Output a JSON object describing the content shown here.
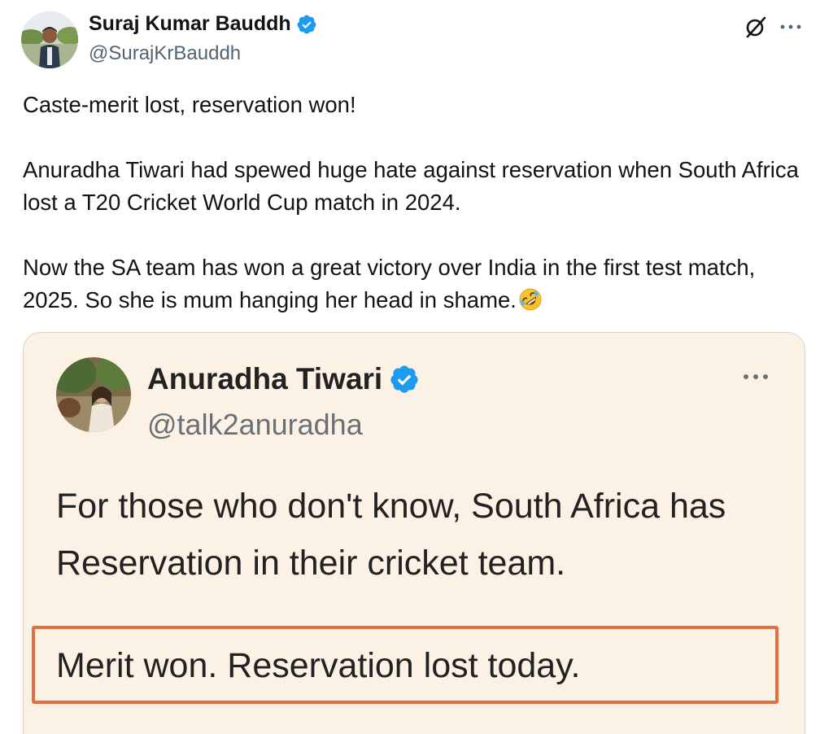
{
  "tweet": {
    "author": {
      "name": "Suraj Kumar Bauddh",
      "handle": "@SurajKrBauddh",
      "verified": true
    },
    "text": {
      "line1": "Caste-merit lost, reservation won!",
      "paragraph2": "Anuradha Tiwari had spewed huge hate against reservation when South Africa lost a T20 Cricket World Cup match in 2024.",
      "paragraph3": "Now the SA team has won a great victory over India in the first test match, 2025. So she is mum hanging her head in shame.",
      "emoji": "rolling-on-floor-laughing"
    },
    "icons": {
      "grok": "grok-icon",
      "more": "more-icon"
    }
  },
  "quoted": {
    "author": {
      "name": "Anuradha Tiwari",
      "handle": "@talk2anuradha",
      "verified": true
    },
    "text": "For those who don't know, South Africa has Reservation in their cricket team.",
    "highlighted_text": "Merit won. Reservation lost today.",
    "highlight_color": "#e07040",
    "background": "#fcf1e5"
  },
  "colors": {
    "verified_blue": "#1d9bf0",
    "text_primary": "#0f1419",
    "text_secondary": "#536471"
  }
}
